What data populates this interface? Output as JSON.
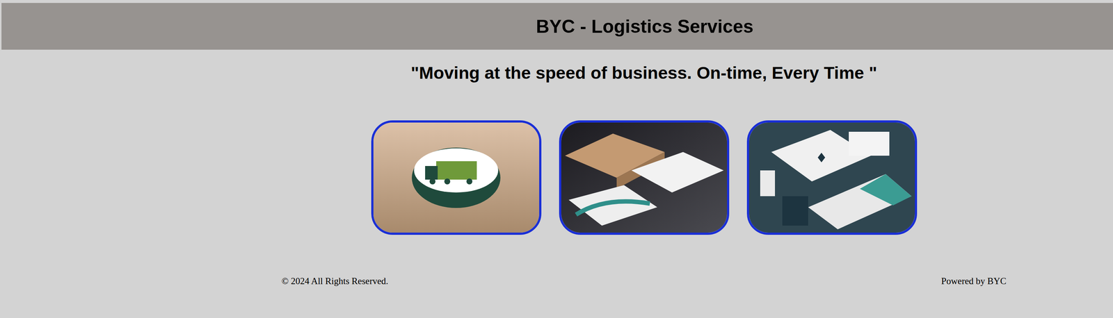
{
  "header": {
    "title": "BYC - Logistics Services"
  },
  "tagline": "\"Moving at the speed of business. On-time, Every Time \"",
  "footer": {
    "copyright": "© 2024 All Rights Reserved.",
    "powered": "Powered by BYC"
  }
}
